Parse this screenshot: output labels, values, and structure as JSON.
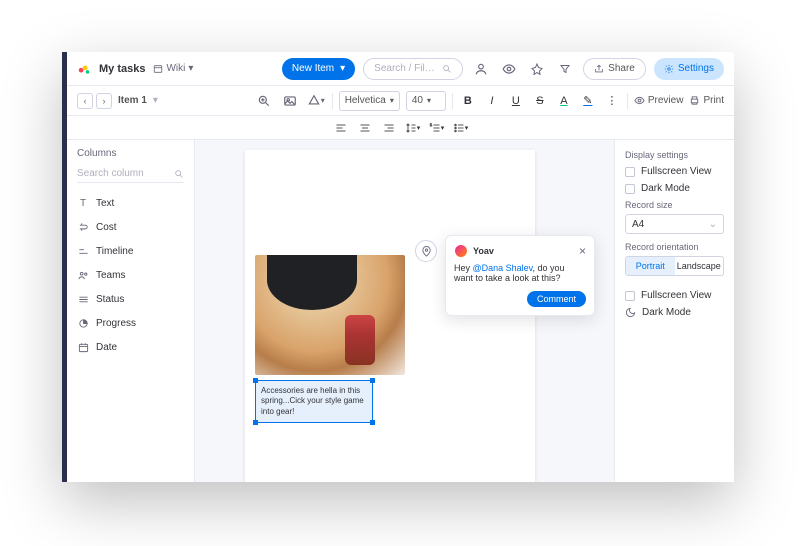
{
  "header": {
    "title": "My tasks",
    "view": "Wiki",
    "new_item": "New Item",
    "search_placeholder": "Search / Filter Board",
    "share": "Share",
    "settings": "Settings"
  },
  "breadcrumb": {
    "item": "Item 1"
  },
  "toolbar": {
    "font": "Helvetica",
    "size": "40",
    "preview": "Preview",
    "print": "Print"
  },
  "columns": {
    "heading": "Columns",
    "search_placeholder": "Search column",
    "items": [
      {
        "icon": "text-icon",
        "label": "Text"
      },
      {
        "icon": "cost-icon",
        "label": "Cost"
      },
      {
        "icon": "timeline-icon",
        "label": "Timeline"
      },
      {
        "icon": "teams-icon",
        "label": "Teams"
      },
      {
        "icon": "status-icon",
        "label": "Status"
      },
      {
        "icon": "progress-icon",
        "label": "Progress"
      },
      {
        "icon": "date-icon",
        "label": "Date"
      }
    ]
  },
  "canvas": {
    "caption": "Accessories are hella in this spring...Cick your style game into gear!"
  },
  "comment_popup": {
    "author": "Yoav",
    "body_pre": "Hey ",
    "mention": "@Dana Shalev",
    "body_post": ", do you want to take a look at this?",
    "button": "Comment"
  },
  "right_panel": {
    "heading": "Display settings",
    "fullscreen": "Fullscreen View",
    "darkmode": "Dark Mode",
    "record_size_label": "Record size",
    "record_size_value": "A4",
    "orientation_label": "Record orientation",
    "portrait": "Portrait",
    "landscape": "Landscape"
  }
}
